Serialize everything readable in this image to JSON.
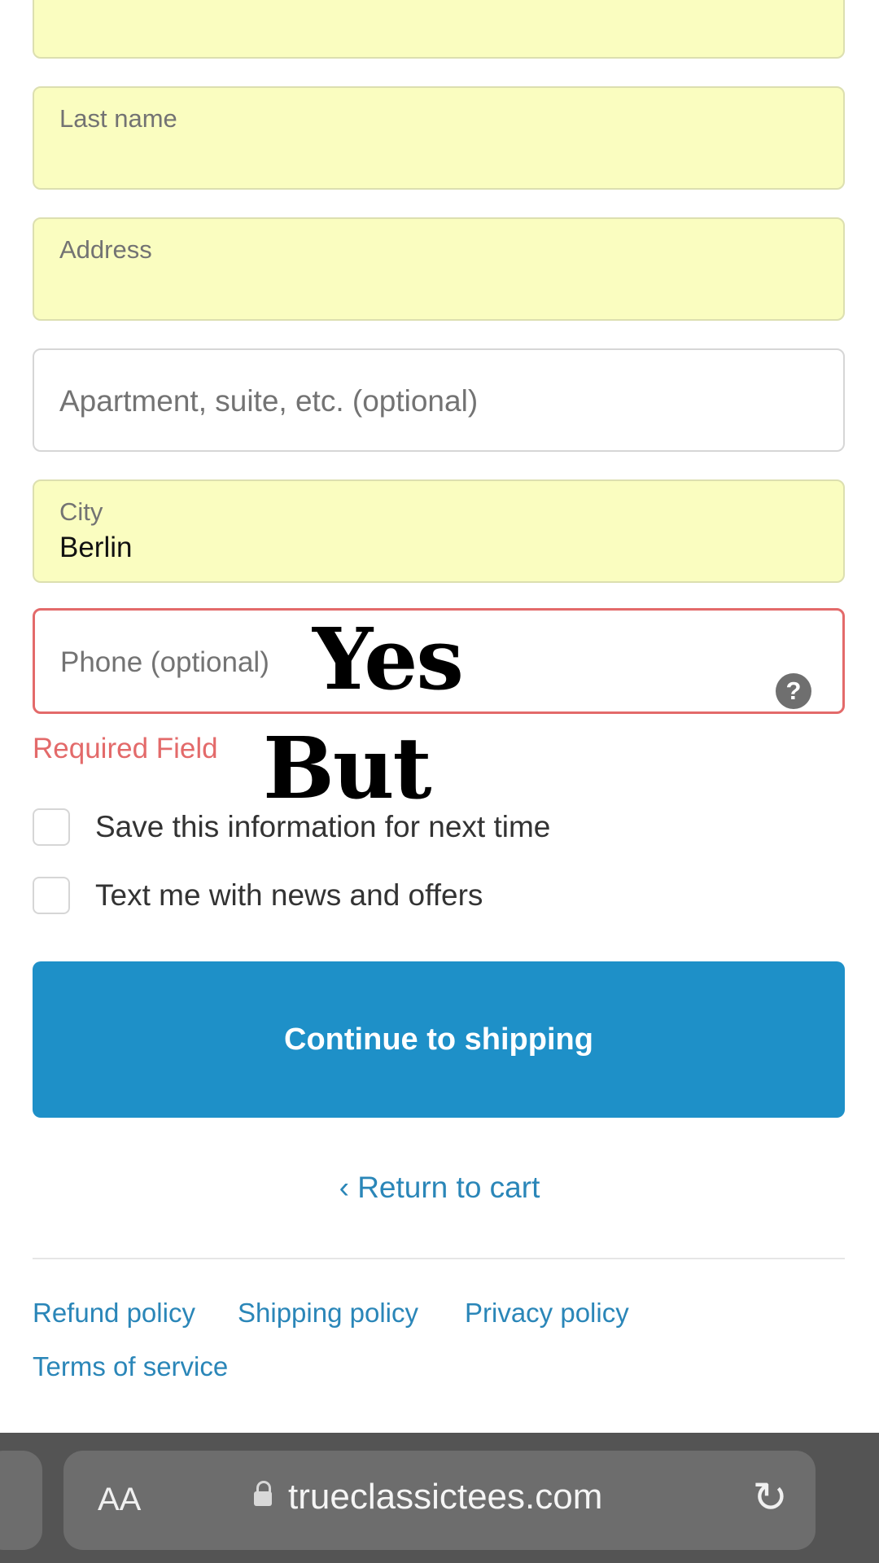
{
  "form": {
    "last_name_label": "Last name",
    "address_label": "Address",
    "apartment_placeholder": "Apartment, suite, etc. (optional)",
    "city_label": "City",
    "city_value": "Berlin",
    "phone_placeholder": "Phone (optional)",
    "phone_help_icon": "?",
    "error_message": "Required Field"
  },
  "meme": {
    "top_text": "Yes",
    "bottom_text": "But"
  },
  "checkboxes": {
    "save_info": "Save this information for next time",
    "text_offers": "Text me with news and offers"
  },
  "actions": {
    "continue_label": "Continue to shipping",
    "return_label": "‹ Return to cart"
  },
  "footer": {
    "refund": "Refund policy",
    "shipping": "Shipping policy",
    "privacy": "Privacy policy",
    "terms": "Terms of service"
  },
  "browser": {
    "text_size_button": "AA",
    "url": "trueclassictees.com",
    "reload_icon": "↻"
  },
  "colors": {
    "autofill_bg": "#fafdc0",
    "error": "#e36a6a",
    "primary": "#1e90c8",
    "link": "#2a86b8"
  }
}
